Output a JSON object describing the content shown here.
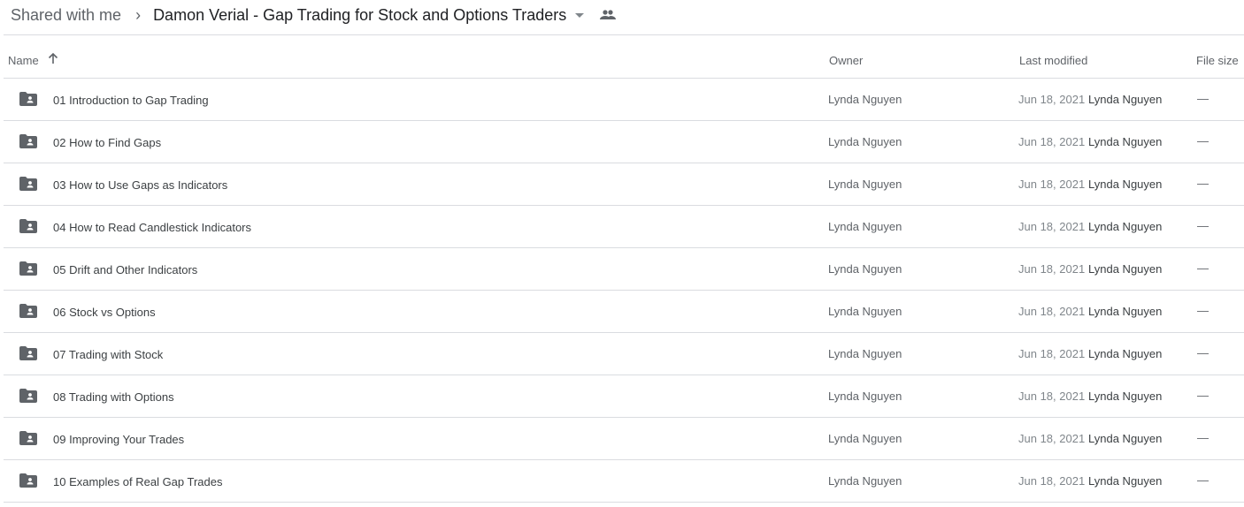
{
  "breadcrumb": {
    "parent": "Shared with me",
    "current": "Damon Verial - Gap Trading for Stock and Options Traders"
  },
  "columns": {
    "name": "Name",
    "owner": "Owner",
    "last_modified": "Last modified",
    "file_size": "File size"
  },
  "rows": [
    {
      "name": "01 Introduction to Gap Trading",
      "owner": "Lynda Nguyen",
      "date": "Jun 18, 2021",
      "modified_by": "Lynda Nguyen",
      "size": "—"
    },
    {
      "name": "02 How to Find Gaps",
      "owner": "Lynda Nguyen",
      "date": "Jun 18, 2021",
      "modified_by": "Lynda Nguyen",
      "size": "—"
    },
    {
      "name": "03 How to Use Gaps as Indicators",
      "owner": "Lynda Nguyen",
      "date": "Jun 18, 2021",
      "modified_by": "Lynda Nguyen",
      "size": "—"
    },
    {
      "name": "04 How to Read Candlestick Indicators",
      "owner": "Lynda Nguyen",
      "date": "Jun 18, 2021",
      "modified_by": "Lynda Nguyen",
      "size": "—"
    },
    {
      "name": "05 Drift and Other Indicators",
      "owner": "Lynda Nguyen",
      "date": "Jun 18, 2021",
      "modified_by": "Lynda Nguyen",
      "size": "—"
    },
    {
      "name": "06 Stock vs Options",
      "owner": "Lynda Nguyen",
      "date": "Jun 18, 2021",
      "modified_by": "Lynda Nguyen",
      "size": "—"
    },
    {
      "name": "07 Trading with Stock",
      "owner": "Lynda Nguyen",
      "date": "Jun 18, 2021",
      "modified_by": "Lynda Nguyen",
      "size": "—"
    },
    {
      "name": "08 Trading with Options",
      "owner": "Lynda Nguyen",
      "date": "Jun 18, 2021",
      "modified_by": "Lynda Nguyen",
      "size": "—"
    },
    {
      "name": "09 Improving Your Trades",
      "owner": "Lynda Nguyen",
      "date": "Jun 18, 2021",
      "modified_by": "Lynda Nguyen",
      "size": "—"
    },
    {
      "name": "10 Examples of Real Gap Trades",
      "owner": "Lynda Nguyen",
      "date": "Jun 18, 2021",
      "modified_by": "Lynda Nguyen",
      "size": "—"
    }
  ]
}
